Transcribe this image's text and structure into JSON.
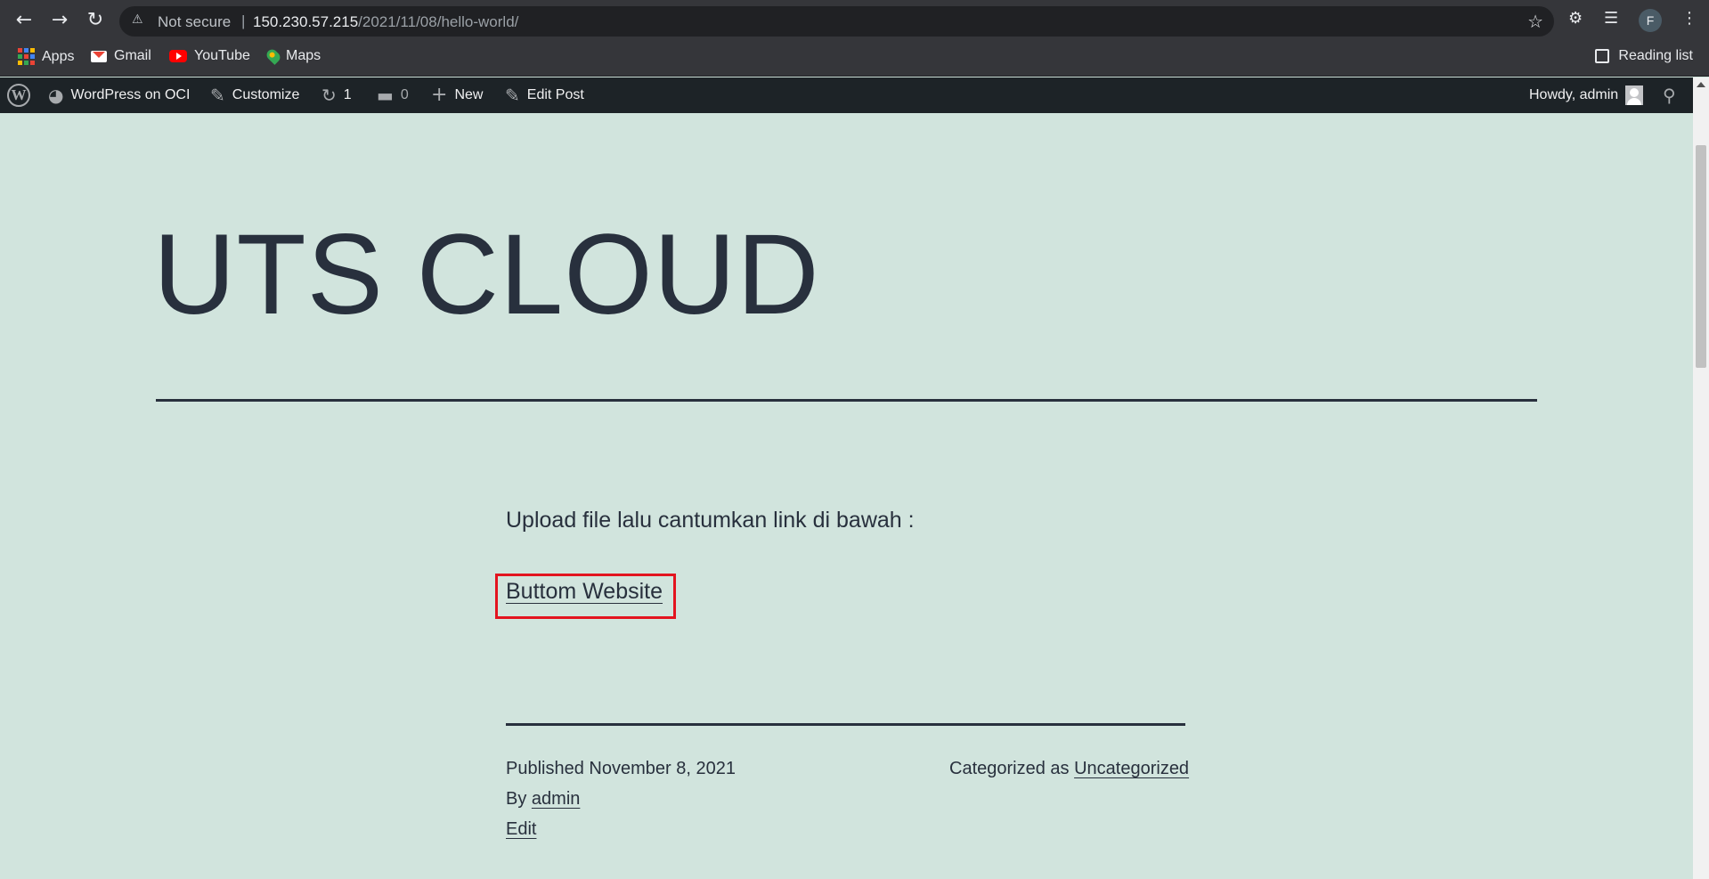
{
  "browser": {
    "not_secure": "Not secure",
    "url_host": "150.230.57.215",
    "url_path": "/2021/11/08/hello-world/",
    "profile_initial": "F"
  },
  "bookmarks": {
    "items": [
      {
        "label": "Apps",
        "icon": "apps-grid-icon"
      },
      {
        "label": "Gmail",
        "icon": "gmail-icon"
      },
      {
        "label": "YouTube",
        "icon": "youtube-icon"
      },
      {
        "label": "Maps",
        "icon": "maps-icon"
      }
    ],
    "reading_list": "Reading list"
  },
  "adminbar": {
    "site_name": "WordPress on OCI",
    "customize": "Customize",
    "updates_count": "1",
    "comments_count": "0",
    "new": "New",
    "edit_post": "Edit Post",
    "howdy": "Howdy, admin"
  },
  "page": {
    "site_title": "UTS CLOUD",
    "post_text": "Upload file lalu cantumkan link di bawah :",
    "link_text": "Buttom Website",
    "published_label": "Published",
    "published_date": "November 8, 2021",
    "by_label": "By",
    "author": "admin",
    "edit": "Edit",
    "categorized_label": "Categorized as",
    "category": "Uncategorized"
  },
  "colors": {
    "page_bg": "#d1e4dd",
    "text": "#28303d",
    "adminbar_bg": "#1d2327",
    "highlight_box": "#e3141f"
  }
}
